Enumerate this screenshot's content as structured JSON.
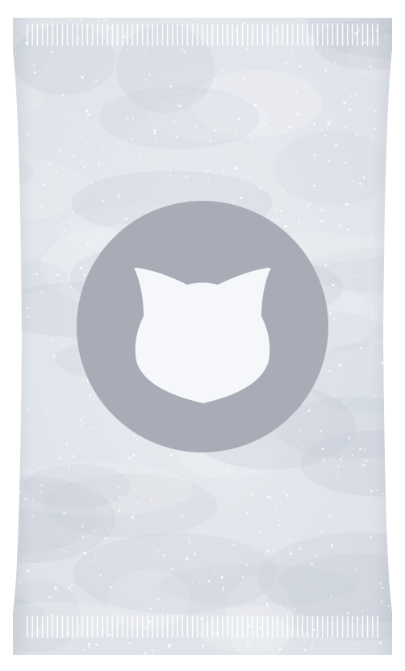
{
  "pack": {
    "base_color": "#dde1e8",
    "shade_color": "#b9c0cc",
    "sparkle_color": "#ffffff",
    "seal_stripe_color": "#ffffff"
  },
  "emblem": {
    "icon": "cat-head-icon",
    "circle_color": "#a7acb6",
    "icon_color": "#f5f7fa"
  }
}
